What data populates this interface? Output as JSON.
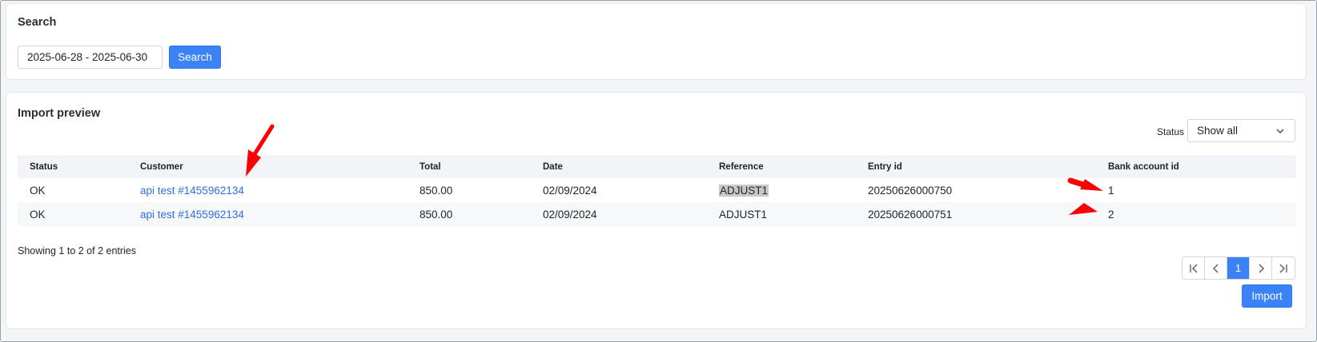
{
  "search": {
    "title": "Search",
    "date_range_value": "2025-06-28 - 2025-06-30",
    "button_label": "Search"
  },
  "preview": {
    "title": "Import preview",
    "status_filter": {
      "label": "Status",
      "selected": "Show all"
    },
    "columns": [
      "Status",
      "Customer",
      "Total",
      "Date",
      "Reference",
      "Entry id",
      "Bank account id"
    ],
    "rows": [
      {
        "status": "OK",
        "customer": "api test #1455962134",
        "total": "850.00",
        "date": "02/09/2024",
        "reference": "ADJUST1",
        "entry_id": "20250626000750",
        "bank_account_id": "1"
      },
      {
        "status": "OK",
        "customer": "api test #1455962134",
        "total": "850.00",
        "date": "02/09/2024",
        "reference": "ADJUST1",
        "entry_id": "20250626000751",
        "bank_account_id": "2"
      }
    ],
    "showing_text": "Showing 1 to 2 of 2 entries",
    "pagination": {
      "current_page": "1"
    },
    "import_button_label": "Import"
  },
  "colors": {
    "accent": "#3b82f6",
    "link": "#2f6fe4",
    "annotation": "#ff0000"
  },
  "icons": [
    "chevron-down-icon",
    "first-page-icon",
    "prev-page-icon",
    "next-page-icon",
    "last-page-icon"
  ]
}
